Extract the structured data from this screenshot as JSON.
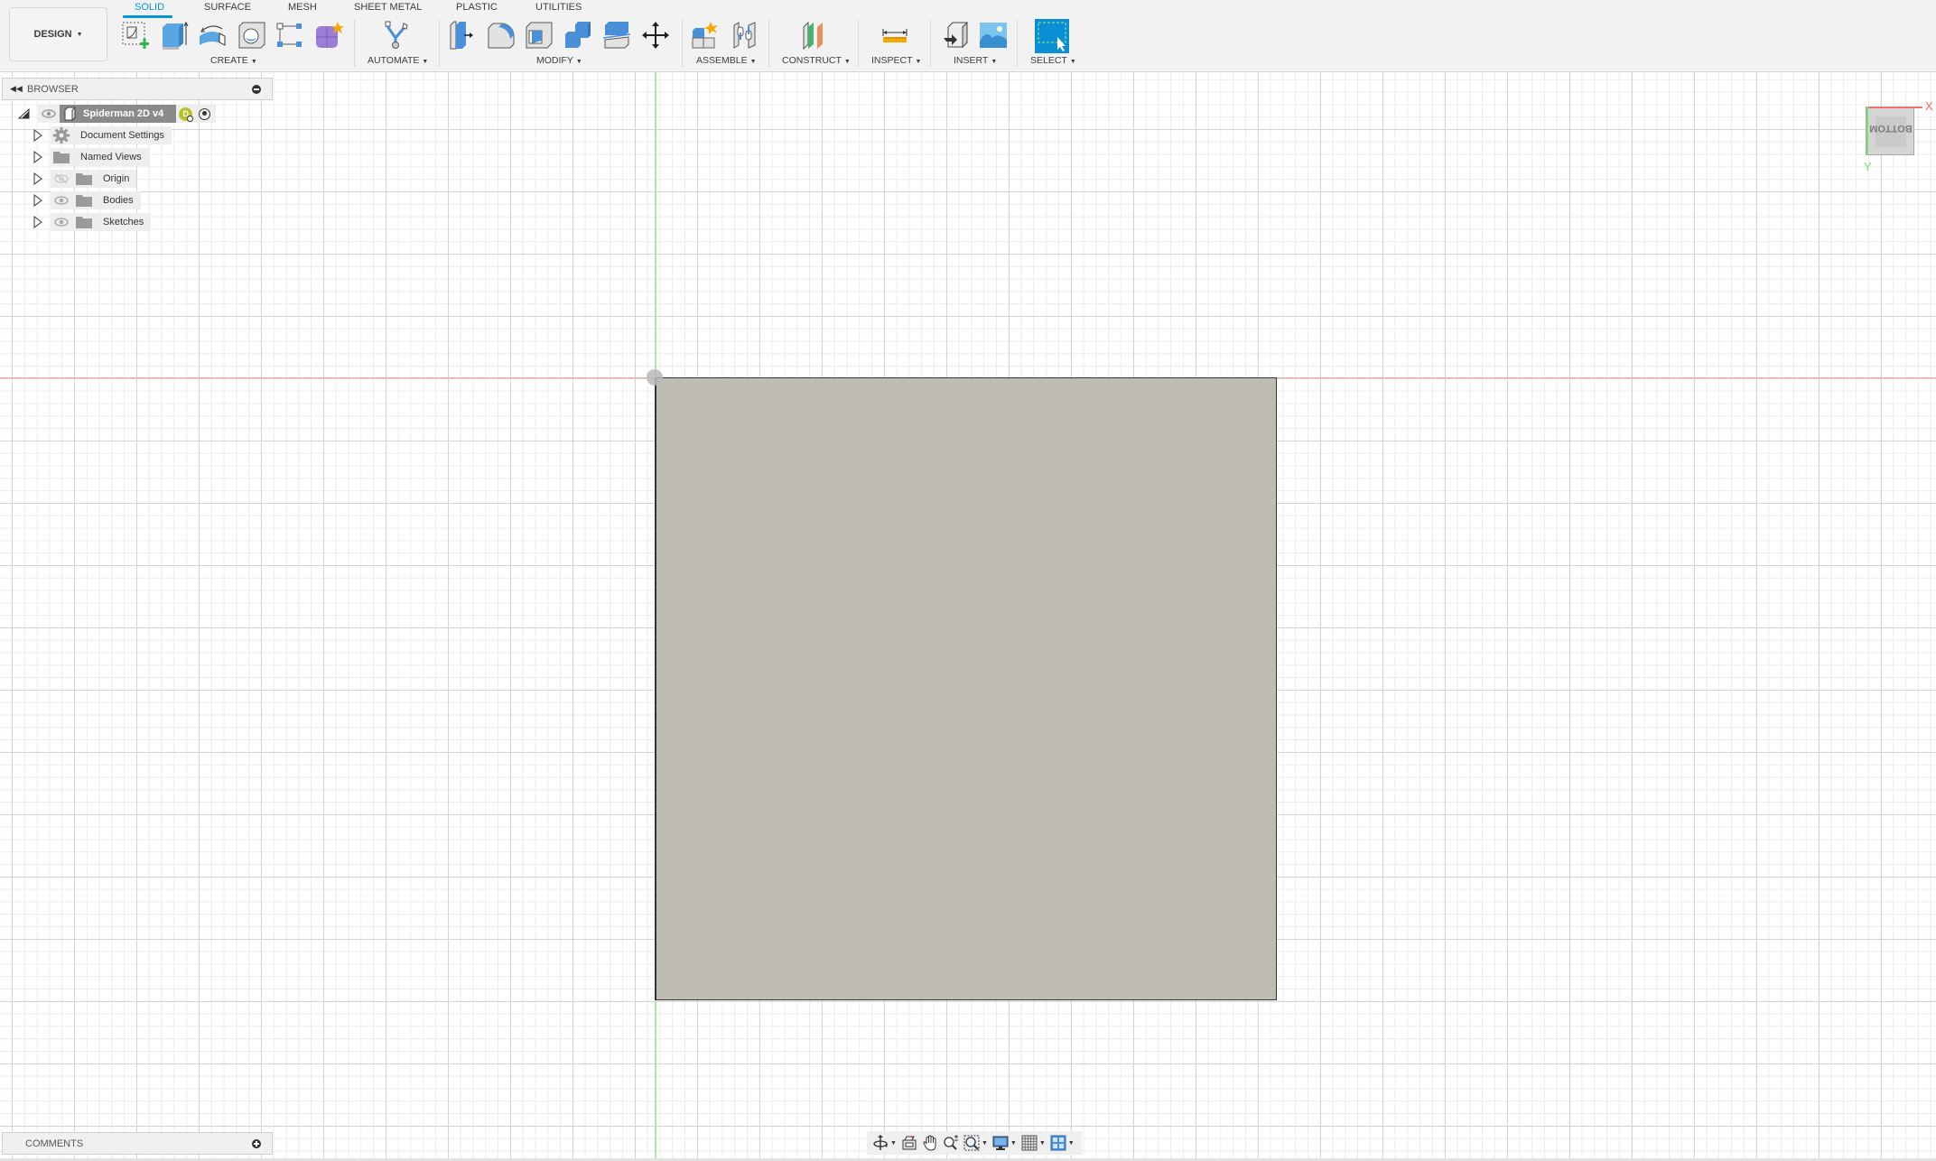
{
  "workspace": {
    "label": "DESIGN"
  },
  "tabs": [
    {
      "label": "SOLID",
      "active": true
    },
    {
      "label": "SURFACE",
      "active": false
    },
    {
      "label": "MESH",
      "active": false
    },
    {
      "label": "SHEET METAL",
      "active": false
    },
    {
      "label": "PLASTIC",
      "active": false
    },
    {
      "label": "UTILITIES",
      "active": false
    }
  ],
  "toolbar_groups": {
    "create": {
      "label": "CREATE",
      "tools": [
        "create-sketch",
        "extrude",
        "revolve",
        "hole",
        "pattern",
        "create-form"
      ]
    },
    "automate": {
      "label": "AUTOMATE",
      "tools": [
        "automate"
      ]
    },
    "modify": {
      "label": "MODIFY",
      "tools": [
        "press-pull",
        "fillet",
        "shell",
        "combine",
        "split-body",
        "move-copy"
      ]
    },
    "assemble": {
      "label": "ASSEMBLE",
      "tools": [
        "new-component",
        "joint"
      ]
    },
    "construct": {
      "label": "CONSTRUCT",
      "tools": [
        "offset-plane"
      ]
    },
    "inspect": {
      "label": "INSPECT",
      "tools": [
        "measure"
      ]
    },
    "insert": {
      "label": "INSERT",
      "tools": [
        "insert-derive",
        "insert-canvas"
      ]
    },
    "select": {
      "label": "SELECT",
      "tools": [
        "select"
      ]
    }
  },
  "browser": {
    "title": "BROWSER",
    "root": {
      "label": "Spiderman 2D v4",
      "badge": "D"
    },
    "items": [
      {
        "label": "Document Settings",
        "icon": "gear-icon",
        "has_eye": false
      },
      {
        "label": "Named Views",
        "icon": "folder-icon",
        "has_eye": false
      },
      {
        "label": "Origin",
        "icon": "folder-icon",
        "has_eye": true,
        "visible": false
      },
      {
        "label": "Bodies",
        "icon": "folder-icon",
        "has_eye": true,
        "visible": true
      },
      {
        "label": "Sketches",
        "icon": "folder-icon",
        "has_eye": true,
        "visible": true
      }
    ]
  },
  "viewcube": {
    "face": "BOTTOM",
    "x_label": "X",
    "y_label": "Y"
  },
  "comments": {
    "title": "COMMENTS"
  },
  "navbar": {
    "tools": [
      "orbit",
      "look-at",
      "pan",
      "zoom",
      "fit",
      "display-settings",
      "grid-snaps",
      "viewports"
    ]
  },
  "colors": {
    "accent": "#0696d7",
    "body_fill": "#bfbcb4",
    "x_axis": "#f07070",
    "y_axis": "#76e276"
  }
}
